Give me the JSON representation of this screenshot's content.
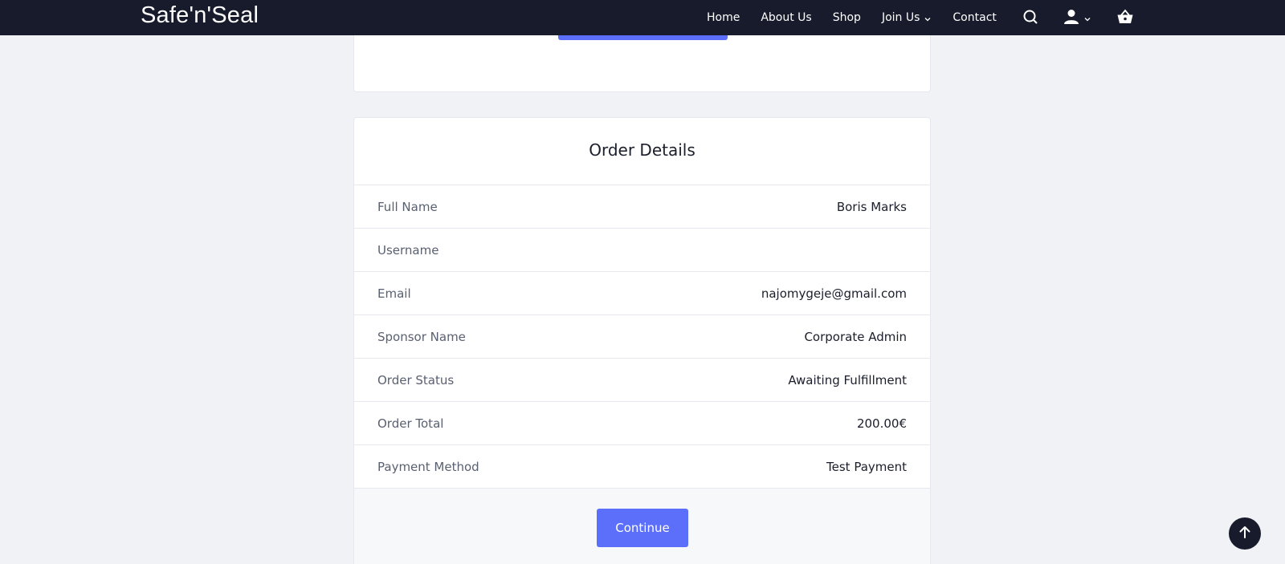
{
  "brand": "Safe'n'Seal",
  "nav": {
    "items": [
      {
        "label": "Home"
      },
      {
        "label": "About Us"
      },
      {
        "label": "Shop"
      },
      {
        "label": "Join Us",
        "has_dropdown": true
      },
      {
        "label": "Contact"
      }
    ],
    "icons": [
      "search-icon",
      "user-icon",
      "chevron-down-icon",
      "cart-icon"
    ]
  },
  "order": {
    "title": "Order Details",
    "rows": [
      {
        "label": "Full Name",
        "value": "Boris Marks"
      },
      {
        "label": "Username",
        "value": ""
      },
      {
        "label": "Email",
        "value": "najomygeje@gmail.com"
      },
      {
        "label": "Sponsor Name",
        "value": "Corporate Admin"
      },
      {
        "label": "Order Status",
        "value": "Awaiting Fulfillment"
      },
      {
        "label": "Order Total",
        "value": "200.00€"
      },
      {
        "label": "Payment Method",
        "value": "Test Payment"
      }
    ],
    "continue_label": "Continue"
  },
  "colors": {
    "nav_bg": "#181b2b",
    "accent": "#5b6ffb",
    "page_bg": "#f1f2f6"
  }
}
